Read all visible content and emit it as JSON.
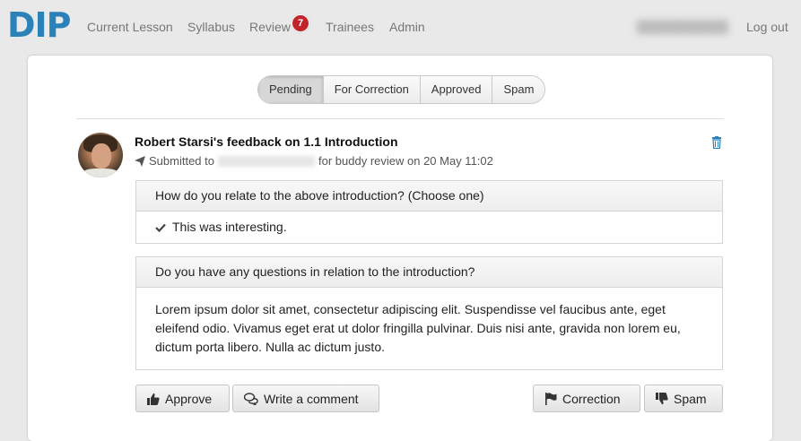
{
  "nav": {
    "logo": "DIP",
    "links": [
      "Current Lesson",
      "Syllabus",
      "Review",
      "Trainees",
      "Admin"
    ],
    "review_badge": "7",
    "logout": "Log out"
  },
  "tabs": [
    "Pending",
    "For Correction",
    "Approved",
    "Spam"
  ],
  "active_tab": "Pending",
  "feedback": {
    "title": "Robert Starsi's feedback on 1.1 Introduction",
    "submitted_prefix": "Submitted to",
    "submitted_suffix": "for buddy review on 20 May 11:02"
  },
  "questions": [
    {
      "question": "How do you relate to the above introduction? (Choose one)",
      "answer": "This was interesting."
    },
    {
      "question": "Do you have any questions in relation to the introduction?",
      "answer": "Lorem ipsum dolor sit amet, consectetur adipiscing elit. Suspendisse vel faucibus ante, eget eleifend odio. Vivamus eget erat ut dolor fringilla pulvinar. Duis nisi ante, gravida non lorem eu, dictum porta libero. Nulla ac dictum justo."
    }
  ],
  "actions": {
    "approve": "Approve",
    "comment": "Write a comment",
    "correction": "Correction",
    "spam": "Spam"
  },
  "colors": {
    "brand": "#2a82b8",
    "badge": "#c0242a"
  }
}
